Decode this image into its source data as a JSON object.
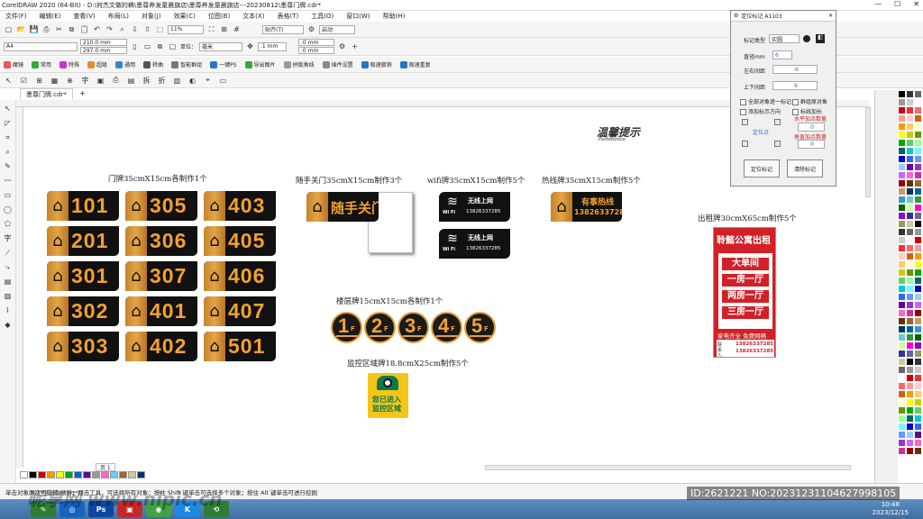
{
  "window": {
    "title": "CorelDRAW 2020 (64-Bit) - D:\\何杰文做的稿\\墨尊养发童晨旗店\\墨尊养发童晨旗店---20230812\\墨尊门牌.cdr*"
  },
  "menu": [
    "文件(F)",
    "编辑(E)",
    "查看(V)",
    "布局(L)",
    "对象(J)",
    "效果(C)",
    "位图(B)",
    "文本(X)",
    "表格(T)",
    "工具(O)",
    "窗口(W)",
    "帮助(H)"
  ],
  "toolbar": {
    "zoom": "11%",
    "snap": "贴齐(T)",
    "launch": "启动",
    "page_size": "A4",
    "width": "210.0 mm",
    "height": "297.0 mm",
    "units_label": "单位：",
    "units": "毫米",
    "nudge": ".1 mm",
    "dup_x": ".0 mm",
    "dup_y": ".0 mm"
  },
  "plugins": [
    "魔镜",
    "常用",
    "特殊",
    "超级",
    "通用",
    "转曲",
    "智能群组",
    "一键PS",
    "导出图片",
    "拼版角线",
    "插件设置",
    "极速撤销",
    "极速重复"
  ],
  "document": {
    "tab": "墨尊门牌.cdr*"
  },
  "labels": {
    "door": "门牌35cmX15cm各制作1个",
    "toilet": "随手关门35cmX15cm制作3个",
    "wifi": "wifi牌35cmX15cm制作5个",
    "hotline": "热线牌35cmX15cm制作5个",
    "rent": "出租牌30cmX65cm制作5个",
    "floor": "楼层牌15cmX15cm各制作1个",
    "monitor": "监控区域牌18.8cmX25cm制作5个"
  },
  "door_numbers": [
    [
      "101",
      "305",
      "403"
    ],
    [
      "201",
      "306",
      "405"
    ],
    [
      "301",
      "307",
      "406"
    ],
    [
      "302",
      "401",
      "407"
    ],
    [
      "303",
      "402",
      "501"
    ]
  ],
  "signs": {
    "toilet": "随手关门",
    "wifi_title": "无线上网",
    "wifi_tag": "Wi Fi",
    "wifi_num": "13826337285",
    "hotline_title": "有事热线",
    "hotline_num": "13826337285",
    "polite_cn": "温馨提示",
    "polite_en": "PoliteNotice",
    "rent_title": "聆懿公寓出租",
    "rent_items": [
      "大单间",
      "一房一厅",
      "两房一厅",
      "三房一厅"
    ],
    "rent_note": "家电齐全 免费网络",
    "rent_contact": "联系人",
    "rent_phones": [
      "13826337285",
      "13826337285"
    ],
    "monitor_text": [
      "您已进入",
      "监控区域"
    ]
  },
  "floors": [
    "1",
    "2",
    "3",
    "4",
    "5"
  ],
  "floor_suffix": "F",
  "dock": {
    "title": "定位标记 A1103",
    "type_label": "标记类型",
    "type_value": "实圆",
    "diameter_label": "直径mm",
    "diameter": "6",
    "lr_label": "左右间距",
    "lr": "-6",
    "tb_label": "上下间距",
    "tb": "6",
    "opt1": "全部对象逐一标记",
    "opt2": "群组原对象",
    "opt3": "添加标示方向",
    "opt4": "标线加长",
    "h_label": "水平加点数量",
    "h_value": "0",
    "v_label": "垂直加点数量",
    "v_value": "0",
    "pos_label": "定位点",
    "btn_mark": "定位标记",
    "btn_clear": "清除标记"
  },
  "page_tab": "页 1",
  "status": "单击对象两次可旋转/倾斜；双击工具，可选择所有对象；按住 Shift 键单击可选择多个对象；按住 Alt 键单击可进行挖掘",
  "watermark": "昵享网 www.nipic.cn",
  "id_tag": "ID:2621221 NO:20231231104627998105",
  "clock": {
    "time": "10:48",
    "date": "2023/12/15"
  },
  "colors": {
    "accent": "#f3a12f",
    "rent_red": "#d32027",
    "monitor_yellow": "#f5c518"
  },
  "taskbar_apps": [
    "start",
    "cdr",
    "ps",
    "photo",
    "wechat",
    "qq",
    "browser"
  ]
}
